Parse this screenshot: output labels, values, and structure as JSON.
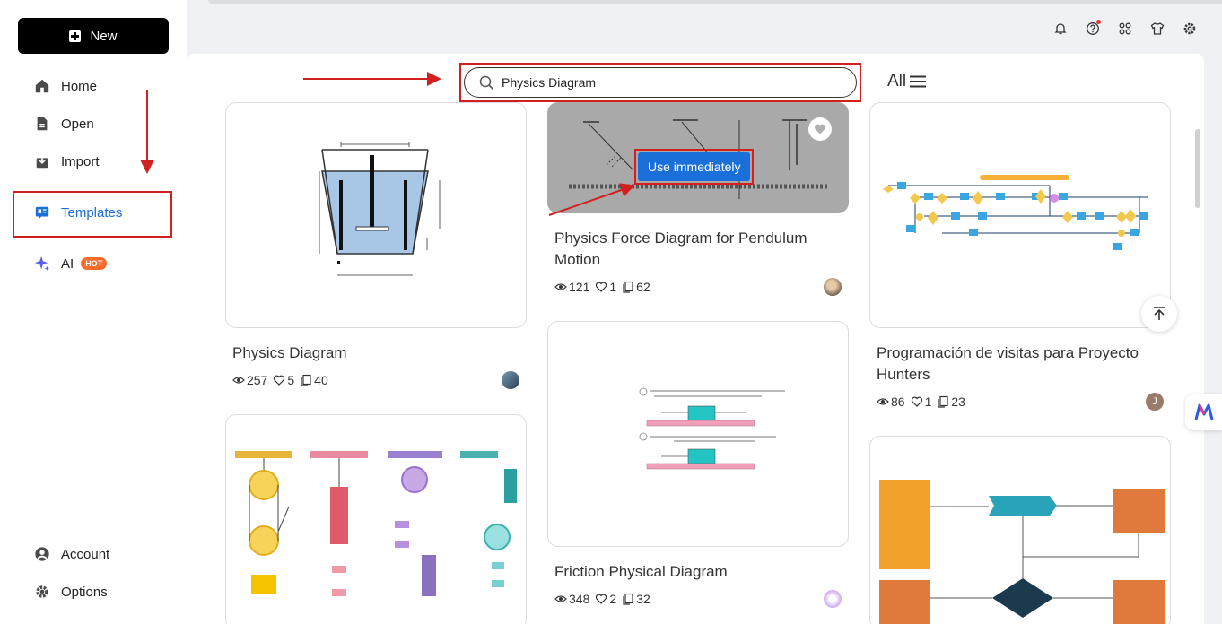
{
  "sidebar": {
    "new_label": "New",
    "items": [
      {
        "label": "Home",
        "icon": "home-icon"
      },
      {
        "label": "Open",
        "icon": "file-icon"
      },
      {
        "label": "Import",
        "icon": "import-icon"
      },
      {
        "label": "Templates",
        "icon": "templates-icon"
      },
      {
        "label": "AI",
        "icon": "sparkle-icon",
        "badge": "HOT"
      }
    ],
    "bottom_items": [
      {
        "label": "Account",
        "icon": "user-icon"
      },
      {
        "label": "Options",
        "icon": "gear-icon"
      }
    ]
  },
  "top_icons": [
    "bell-icon",
    "help-icon",
    "apps-icon",
    "shirt-icon",
    "settings-icon"
  ],
  "search": {
    "value": "Physics Diagram",
    "placeholder": ""
  },
  "filter": {
    "label": "All"
  },
  "cards": [
    {
      "title": "Physics Diagram",
      "views": "257",
      "likes": "5",
      "copies": "40"
    },
    {
      "title": "Physics Force Diagram for Pendulum Motion",
      "views": "121",
      "likes": "1",
      "copies": "62",
      "use_label": "Use immediately"
    },
    {
      "title": "Programación de visitas para Proyecto Hunters",
      "views": "86",
      "likes": "1",
      "copies": "23",
      "avatar_letter": "J"
    },
    {
      "title": "Friction Physical Diagram",
      "views": "348",
      "likes": "2",
      "copies": "32"
    }
  ],
  "colors": {
    "accent": "#1a6fd8",
    "annotation_red": "#d21f1f",
    "hot_badge": "#ff6a2b"
  }
}
